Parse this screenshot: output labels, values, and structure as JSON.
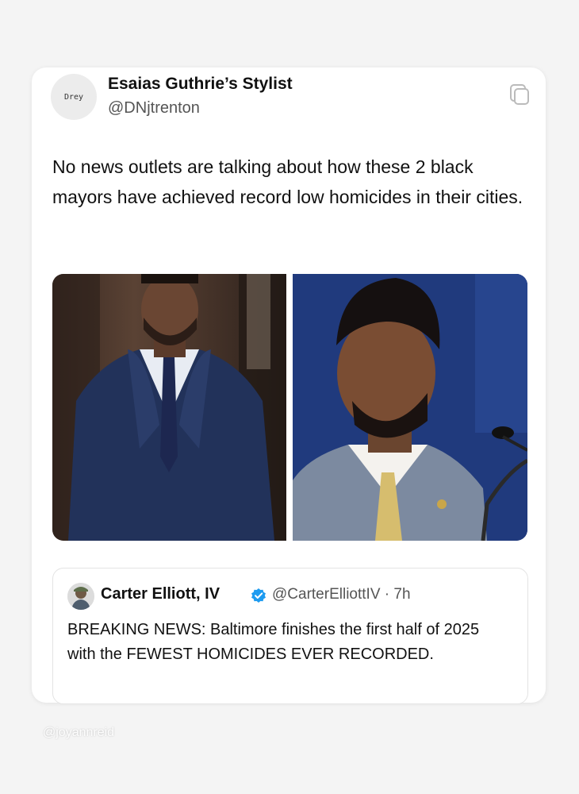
{
  "post": {
    "avatar_text": "Drey",
    "display_name": "Esaias Guthrie’s Stylist",
    "handle": "@DNjtrenton",
    "text": "No news outlets are talking about how these 2 black mayors have achieved record low homicides in their cities."
  },
  "images": [
    {
      "name": "mayor-portrait-left"
    },
    {
      "name": "mayor-portrait-right"
    }
  ],
  "quoted_post": {
    "display_name": "Carter Elliott, IV",
    "handle_time": "@CarterElliottIV · 7h",
    "text": "BREAKING NEWS: Baltimore finishes the first half of 2025 with the FEWEST HOMICIDES EVER RECORDED.",
    "verified_color": "#1d9bf0"
  },
  "watermark": "@joyannreid",
  "icons": {
    "copy": "copy-icon",
    "verified": "verified-badge-icon"
  }
}
